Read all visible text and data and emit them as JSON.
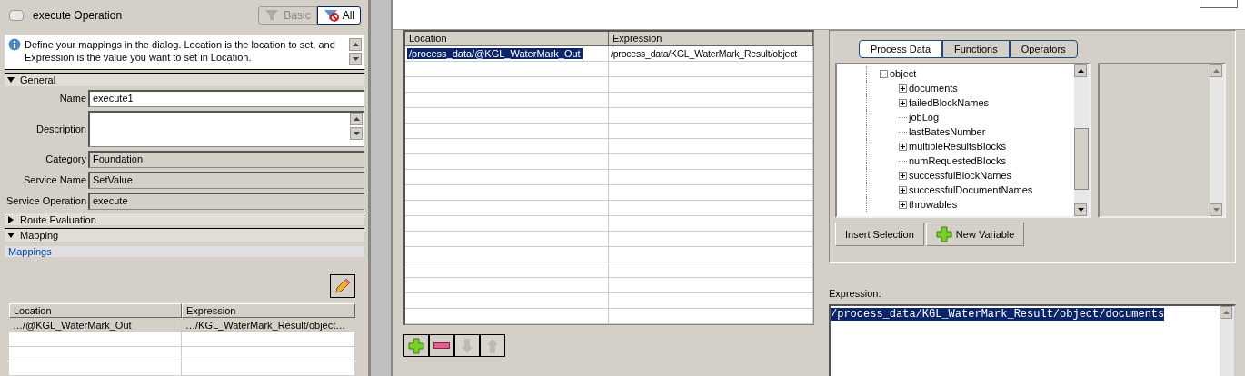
{
  "properties": {
    "title": "execute Operation",
    "checked": false,
    "filter_toggle": [
      {
        "label": "Basic",
        "kind": "funnel",
        "selected": false
      },
      {
        "label": "All",
        "kind": "funnel-off",
        "selected": true
      }
    ],
    "info": "Define your mappings in the dialog.  Location is the location to set, and Expression is the value you want to set in Location.",
    "sections": [
      {
        "title": "General",
        "expanded": true,
        "fields": [
          {
            "label": "Name",
            "value": "execute1",
            "kind": "text",
            "disabled": false
          },
          {
            "label": "Description",
            "kind": "multiline",
            "disabled": false
          },
          {
            "label": "Category",
            "value": "Foundation",
            "kind": "text",
            "disabled": true
          },
          {
            "label": "Service Name",
            "value": "SetValue",
            "kind": "text",
            "disabled": true
          },
          {
            "label": "Service Operation",
            "value": "execute",
            "kind": "text",
            "disabled": true
          }
        ]
      },
      {
        "title": "Route Evaluation",
        "expanded": false
      },
      {
        "title": "Mapping",
        "expanded": true
      }
    ],
    "mappings_link": "Mappings",
    "table": {
      "columns": [
        "Location",
        "Expression"
      ],
      "rows": [
        [
          "…/@KGL_WaterMark_Out",
          "…/KGL_WaterMark_Result/object…"
        ]
      ]
    }
  },
  "dialog": {
    "table": {
      "columns": [
        "Location",
        "Expression"
      ],
      "rows": [
        {
          "cells": [
            "/process_data/@KGL_WaterMark_Out",
            "/process_data/KGL_WaterMark_Result/object"
          ],
          "selected": true
        }
      ]
    },
    "row_buttons": [
      {
        "kind": "add",
        "disabled": false
      },
      {
        "kind": "remove",
        "disabled": false
      },
      {
        "kind": "down",
        "disabled": true
      },
      {
        "kind": "up",
        "disabled": true
      }
    ],
    "tabs": [
      {
        "label": "Process Data",
        "selected": true
      },
      {
        "label": "Functions",
        "selected": false
      },
      {
        "label": "Operators",
        "selected": false
      }
    ],
    "tree": [
      {
        "label": "object",
        "kind": "branch",
        "expanded": true,
        "children": [
          {
            "label": "documents",
            "kind": "branch",
            "expanded": false
          },
          {
            "label": "failedBlockNames",
            "kind": "branch",
            "expanded": false
          },
          {
            "label": "jobLog",
            "kind": "leaf"
          },
          {
            "label": "lastBatesNumber",
            "kind": "leaf"
          },
          {
            "label": "multipleResultsBlocks",
            "kind": "branch",
            "expanded": false
          },
          {
            "label": "numRequestedBlocks",
            "kind": "leaf"
          },
          {
            "label": "successfulBlockNames",
            "kind": "branch",
            "expanded": false
          },
          {
            "label": "successfulDocumentNames",
            "kind": "branch",
            "expanded": false
          },
          {
            "label": "throwables",
            "kind": "branch",
            "expanded": false
          }
        ]
      }
    ],
    "buttons": [
      {
        "label": "Insert Selection",
        "kind": "plain"
      },
      {
        "label": "New Variable",
        "kind": "add"
      }
    ],
    "expression_label": "Expression:",
    "expression": "/process_data/KGL_WaterMark_Result/object/documents"
  }
}
